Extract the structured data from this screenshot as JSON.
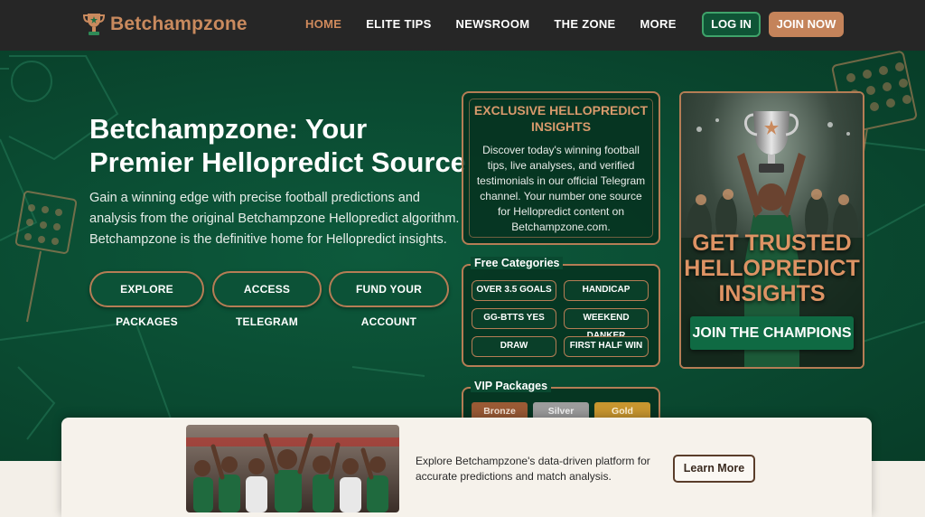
{
  "colors": {
    "nav_bg": "#262626",
    "brand": "#c98a5e",
    "hero_green": "#0a4a31",
    "copper": "#b57d55",
    "login_border": "#3fa36a",
    "join_bg": "#c4835a"
  },
  "nav": {
    "brand": "Betchampzone",
    "logo_icon": "trophy-icon",
    "items": [
      {
        "label": "HOME",
        "active": true
      },
      {
        "label": "ELITE TIPS",
        "active": false
      },
      {
        "label": "NEWSROOM",
        "active": false
      },
      {
        "label": "THE ZONE",
        "active": false
      },
      {
        "label": "MORE",
        "active": false
      }
    ],
    "login": "LOG IN",
    "join": "JOIN NOW"
  },
  "hero": {
    "title_line1": "Betchampzone: Your",
    "title_line2": "Premier Hellopredict Source",
    "description": "Gain a winning edge with precise football predictions and analysis from the original Betchampzone Hellopredict algorithm. Betchampzone is the definitive home for Hellopredict insights.",
    "buttons": [
      "EXPLORE PACKAGES",
      "ACCESS TELEGRAM",
      "FUND YOUR ACCOUNT"
    ]
  },
  "exclusive": {
    "title_line1": "EXCLUSIVE HELLOPREDICT",
    "title_line2": "INSIGHTS",
    "text": "Discover today's winning football tips, live analyses, and verified testimonials in our official Telegram channel. Your number one source for Hellopredict content on Betchampzone.com."
  },
  "free_categories": {
    "legend": "Free Categories",
    "items": [
      "OVER 3.5 GOALS",
      "HANDICAP",
      "GG-BTTS YES",
      "WEEKEND DANKER",
      "DRAW",
      "FIRST HALF WIN"
    ]
  },
  "vip": {
    "legend": "VIP Packages",
    "items": [
      {
        "label": "Bronze",
        "color": "#9a5a35"
      },
      {
        "label": "Silver",
        "color": "#9c9c9c"
      },
      {
        "label": "Gold",
        "color": "#c8962f"
      }
    ]
  },
  "promo": {
    "line1": "GET TRUSTED",
    "line2": "HELLOPREDICT",
    "line3": "INSIGHTS",
    "button": "JOIN THE CHAMPIONS"
  },
  "bottom": {
    "text": "Explore Betchampzone's data-driven platform for accurate predictions and match analysis.",
    "button": "Learn More"
  }
}
